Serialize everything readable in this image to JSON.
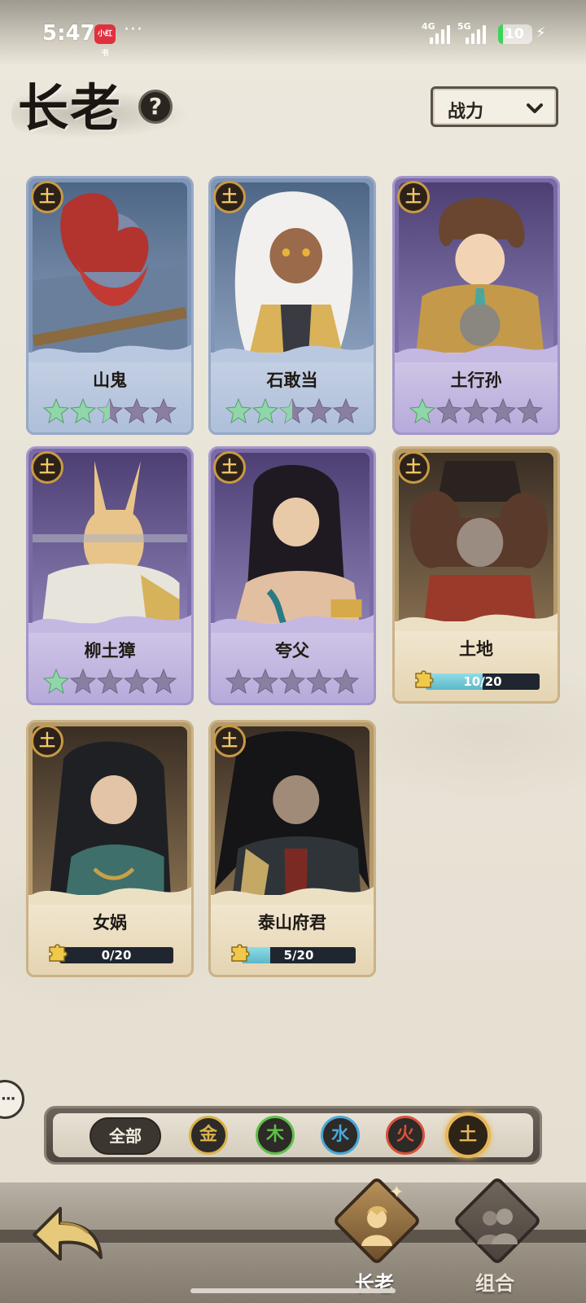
{
  "status_bar": {
    "time": "5:47",
    "app_badge": "小红书",
    "dots": "···",
    "net1": "4G",
    "net2": "5G",
    "battery": "10"
  },
  "header": {
    "title": "长老",
    "help_glyph": "?",
    "sort_label": "战力"
  },
  "cards": [
    {
      "name": "山鬼",
      "element": "土",
      "frame": "blue",
      "stars_filled": 2.5,
      "stars_total": 5
    },
    {
      "name": "石敢当",
      "element": "土",
      "frame": "blue",
      "stars_filled": 2.5,
      "stars_total": 5
    },
    {
      "name": "土行孙",
      "element": "土",
      "frame": "purple",
      "stars_filled": 1,
      "stars_total": 5
    },
    {
      "name": "柳土獐",
      "element": "土",
      "frame": "purple",
      "stars_filled": 1,
      "stars_total": 5
    },
    {
      "name": "夸父",
      "element": "土",
      "frame": "purple",
      "stars_filled": 0,
      "stars_total": 5
    },
    {
      "name": "土地",
      "element": "土",
      "frame": "gold",
      "shards": "10/20",
      "shard_progress": 0.5
    },
    {
      "name": "女娲",
      "element": "土",
      "frame": "gold",
      "shards": "0/20",
      "shard_progress": 0
    },
    {
      "name": "泰山府君",
      "element": "土",
      "frame": "gold",
      "shards": "5/20",
      "shard_progress": 0.25
    }
  ],
  "filters": {
    "all_label": "全部",
    "elements": [
      {
        "label": "金",
        "color": "#d9b24a"
      },
      {
        "label": "木",
        "color": "#5fbf4a"
      },
      {
        "label": "水",
        "color": "#4aa7d9"
      },
      {
        "label": "火",
        "color": "#d9503a"
      },
      {
        "label": "土",
        "color": "#e6b657",
        "selected": true
      }
    ]
  },
  "side_bubble": "···",
  "nav": {
    "tabs": [
      {
        "label": "长老",
        "active": true
      },
      {
        "label": "组合",
        "active": false
      }
    ]
  },
  "colors": {
    "star_on": "#8fd6a8",
    "star_off": "#8a7fa0"
  }
}
